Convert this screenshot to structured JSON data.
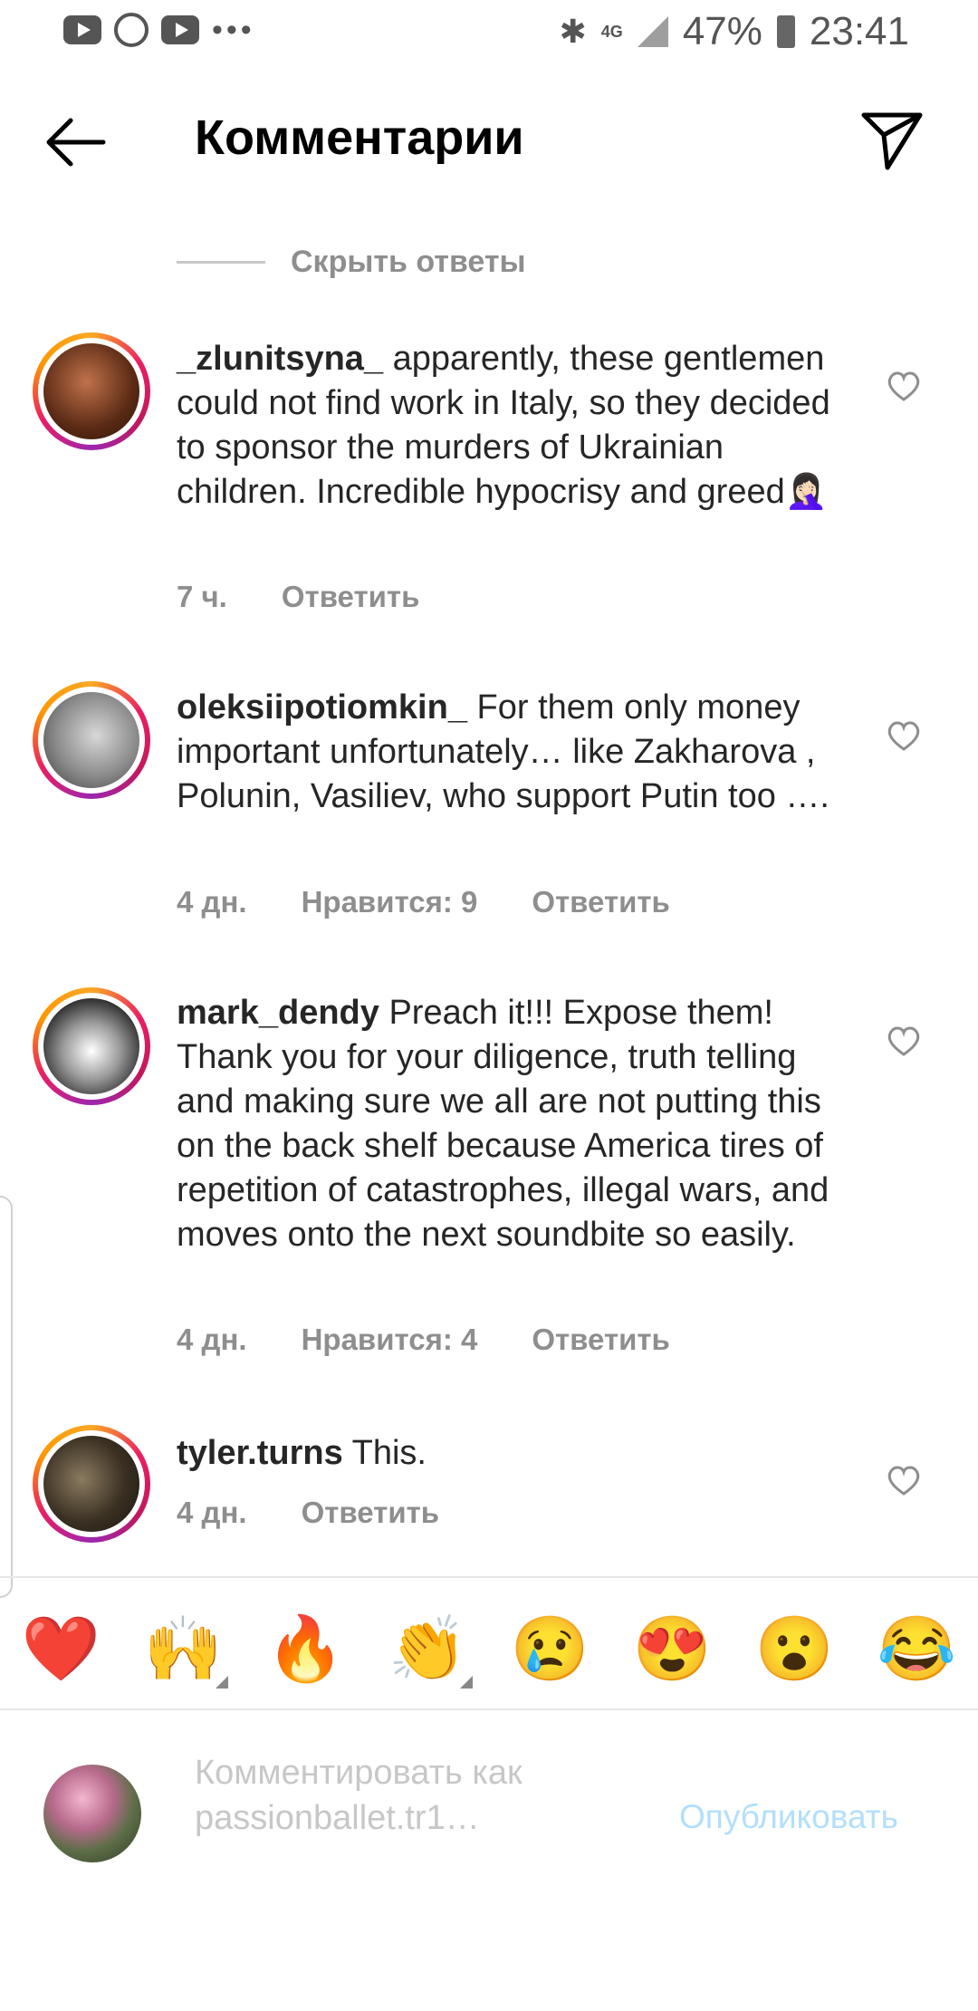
{
  "status_bar": {
    "network": "4G",
    "battery": "47%",
    "time": "23:41",
    "icons": [
      "youtube-icon",
      "whatsapp-icon",
      "youtube-icon",
      "more-icon",
      "bluetooth-icon",
      "signal-icon",
      "battery-icon"
    ]
  },
  "header": {
    "title": "Комментарии"
  },
  "replies": {
    "hide_label": "Скрыть ответы"
  },
  "comments": [
    {
      "username": "_zlunitsyna_",
      "text": "apparently, these gentlemen could not find work in Italy, so they decided to sponsor the murders of Ukrainian children.  Incredible hypocrisy and greed🤦🏻‍♀️",
      "time": "7 ч.",
      "likes": "",
      "reply": "Ответить"
    },
    {
      "username": "oleksiipotiomkin_",
      "text": "For them only money important unfortunately… like Zakharova , Polunin, Vasiliev, who support Putin too ….",
      "time": "4 дн.",
      "likes": "Нравится: 9",
      "reply": "Ответить"
    },
    {
      "username": "mark_dendy",
      "text": "Preach it!!! Expose them! Thank you for your diligence, truth telling and making sure we all are not putting this on the back shelf because America tires of repetition of catastrophes, illegal wars, and moves onto the next soundbite so easily.",
      "time": "4 дн.",
      "likes": "Нравится: 4",
      "reply": "Ответить"
    },
    {
      "username": "tyler.turns",
      "text": "This.",
      "time": "4 дн.",
      "likes": "",
      "reply": "Ответить"
    }
  ],
  "emoji_bar": [
    "❤️",
    "🙌",
    "🔥",
    "👏",
    "😢",
    "😍",
    "😮",
    "😂"
  ],
  "composer": {
    "placeholder": "Комментировать как passionballet.tr1…",
    "publish_label": "Опубликовать"
  },
  "colors": {
    "text": "#262626",
    "muted": "#8e8e8e",
    "publish_disabled": "#b2dffc",
    "heart_outline": "#8e8e8e"
  }
}
